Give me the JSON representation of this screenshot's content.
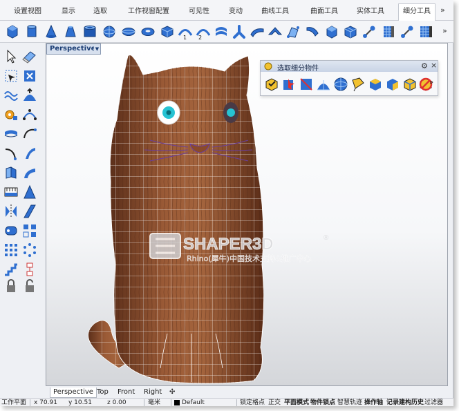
{
  "tabs": [
    "设置视图",
    "显示",
    "选取",
    "工作视窗配置",
    "可见性",
    "变动",
    "曲线工具",
    "曲面工具",
    "实体工具",
    "细分工具"
  ],
  "active_tab": "细分工具",
  "tab_overflow": "»",
  "toolbar": {
    "overflow": "»",
    "icons": [
      "subd-box-icon",
      "subd-cylinder-icon",
      "subd-cone-icon",
      "subd-truncated-cone-icon",
      "subd-tube-icon",
      "subd-sphere-icon",
      "subd-ellipsoid-icon",
      "subd-torus-icon",
      "subd-quadball-icon",
      "subd-loft-icon",
      "subd-sweep1-icon",
      "subd-sweep2-icon",
      "subd-pipe-icon",
      "subd-skin-icon",
      "subd-face-icon",
      "subd-bridge-icon",
      "subd-crease-icon",
      "subd-append-icon",
      "subd-fill-icon",
      "subd-offset-icon",
      "subd-thicken-icon",
      "subd-insert-point-icon",
      "subd-stitch-icon",
      "subd-tools-icon"
    ]
  },
  "viewport": {
    "title": "Perspective",
    "watermark": {
      "brand": "SHAPER3D",
      "registered": "®",
      "subtitle": "Rhino(犀牛)中国技术支持&推广中心"
    }
  },
  "subd_panel": {
    "title": "选取细分物件",
    "gear": "⚙",
    "close": "×",
    "overflow": "»",
    "icons": [
      "select-subd-icon",
      "select-subd-face-icon",
      "select-subd-edge-icon",
      "select-subd-vertex-icon",
      "select-subd-loop-icon",
      "select-subd-ring-icon",
      "select-subd-boundary-icon",
      "select-subd-crease-icon",
      "select-subd-poly-icon",
      "select-none-icon"
    ]
  },
  "view_tabs": [
    "Perspective",
    "Top",
    "Front",
    "Right"
  ],
  "view_tab_add": "✣",
  "status": {
    "cplane": "工作平面",
    "x": "x 70.91",
    "y": "y 10.51",
    "z": "z 0.00",
    "units": "毫米",
    "layer": "Default",
    "snap": "锁定格点",
    "ortho": "正交",
    "planar": "平面模式",
    "osnap": "物件锁点",
    "smarttrack": "智慧轨迹",
    "gumball": "操作轴",
    "history": "记录建构历史",
    "filter": "过滤器"
  },
  "colors": {
    "accent": "#4a7ec9",
    "wood": "#8a4a2a",
    "eye": "#27c3d3",
    "whisker": "#6a3fa0"
  }
}
